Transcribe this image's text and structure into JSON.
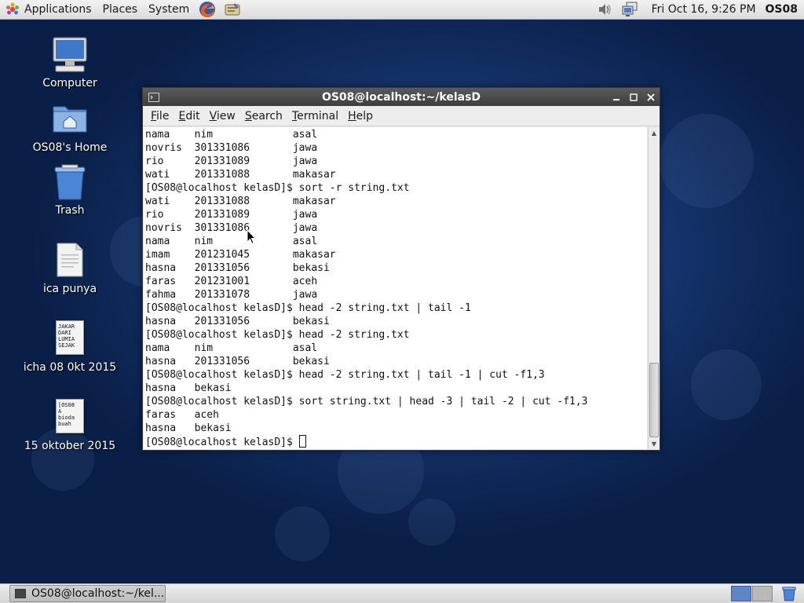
{
  "top_panel": {
    "menus": [
      "Applications",
      "Places",
      "System"
    ],
    "clock": "Fri Oct 16,  9:26 PM",
    "user": "OS08",
    "icons": [
      "gnome-foot-icon",
      "firefox-icon",
      "text-editor-icon",
      "volume-icon",
      "network-icon"
    ]
  },
  "desktop_icons": [
    {
      "label": "Computer",
      "icon": "computer-icon"
    },
    {
      "label": "OS08's Home",
      "icon": "home-folder-icon"
    },
    {
      "label": "Trash",
      "icon": "trash-icon"
    },
    {
      "label": "ica punya",
      "icon": "text-file-icon"
    },
    {
      "label": "icha 08 0kt 2015",
      "icon": "text-file-icon",
      "thumb_text": "JAKAR\nDARI\nLUMIA\nSEJAK"
    },
    {
      "label": "15 oktober 2015",
      "icon": "text-file-icon",
      "thumb_text": "[OS08\nA\nbioda\nbuah"
    }
  ],
  "terminal": {
    "title": "OS08@localhost:~/kelasD",
    "menus": [
      {
        "label": "File",
        "mnemonic": "F",
        "rest": "ile"
      },
      {
        "label": "Edit",
        "mnemonic": "E",
        "rest": "dit"
      },
      {
        "label": "View",
        "mnemonic": "V",
        "rest": "iew"
      },
      {
        "label": "Search",
        "mnemonic": "S",
        "rest": "earch"
      },
      {
        "label": "Terminal",
        "mnemonic": "T",
        "rest": "erminal"
      },
      {
        "label": "Help",
        "mnemonic": "H",
        "rest": "elp"
      }
    ],
    "lines": [
      "nama    nim             asal",
      "novris  301331086       jawa",
      "rio     201331089       jawa",
      "wati    201331088       makasar",
      "[OS08@localhost kelasD]$ sort -r string.txt",
      "wati    201331088       makasar",
      "rio     201331089       jawa",
      "novris  301331086       jawa",
      "nama    nim             asal",
      "imam    201231045       makasar",
      "hasna   201331056       bekasi",
      "faras   201231001       aceh",
      "fahma   201331078       jawa",
      "[OS08@localhost kelasD]$ head -2 string.txt | tail -1",
      "hasna   201331056       bekasi",
      "[OS08@localhost kelasD]$ head -2 string.txt",
      "nama    nim             asal",
      "hasna   201331056       bekasi",
      "[OS08@localhost kelasD]$ head -2 string.txt | tail -1 | cut -f1,3",
      "hasna   bekasi",
      "[OS08@localhost kelasD]$ sort string.txt | head -3 | tail -2 | cut -f1,3",
      "faras   aceh",
      "hasna   bekasi"
    ],
    "prompt": "[OS08@localhost kelasD]$ "
  },
  "bottom_panel": {
    "task_label": "OS08@localhost:~/kel..."
  },
  "colors": {
    "panel_bg": "#e4e4e4",
    "titlebar": "#4a4a4a",
    "desktop": "#1c4385",
    "workspace_active": "#5f86c4"
  }
}
